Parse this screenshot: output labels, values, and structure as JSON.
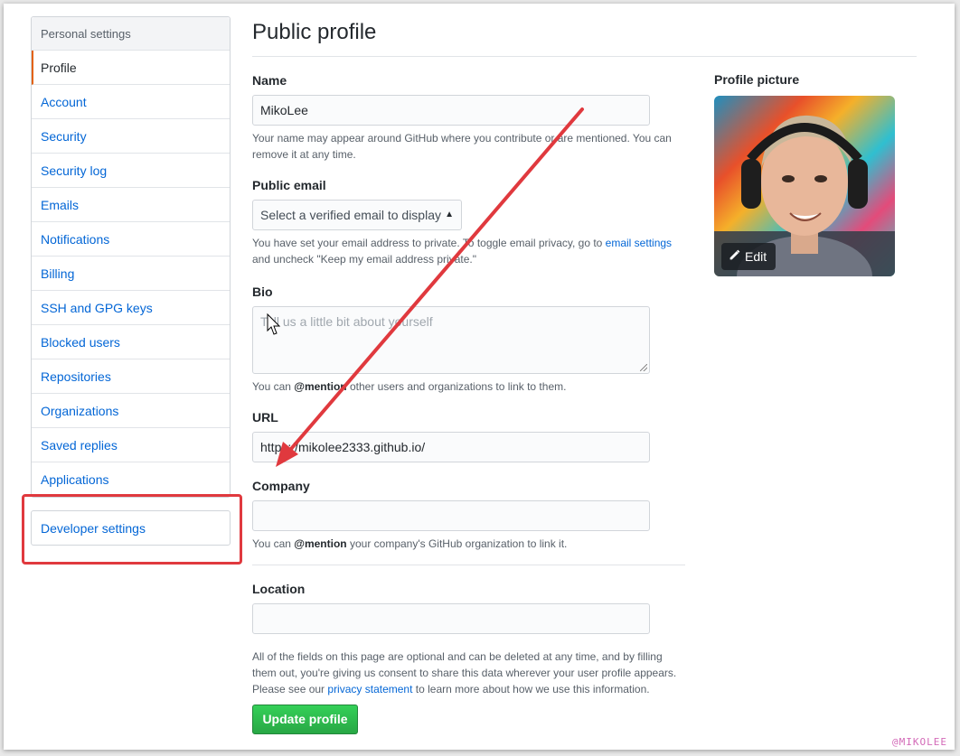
{
  "sidebar": {
    "header": "Personal settings",
    "items": [
      {
        "label": "Profile"
      },
      {
        "label": "Account"
      },
      {
        "label": "Security"
      },
      {
        "label": "Security log"
      },
      {
        "label": "Emails"
      },
      {
        "label": "Notifications"
      },
      {
        "label": "Billing"
      },
      {
        "label": "SSH and GPG keys"
      },
      {
        "label": "Blocked users"
      },
      {
        "label": "Repositories"
      },
      {
        "label": "Organizations"
      },
      {
        "label": "Saved replies"
      },
      {
        "label": "Applications"
      }
    ],
    "developer_settings": "Developer settings"
  },
  "main": {
    "title": "Public profile",
    "name": {
      "label": "Name",
      "value": "MikoLee",
      "note": "Your name may appear around GitHub where you contribute or are mentioned. You can remove it at any time."
    },
    "public_email": {
      "label": "Public email",
      "placeholder": "Select a verified email to display",
      "note_prefix": "You have set your email address to private. To toggle email privacy, go to ",
      "note_link": "email settings",
      "note_suffix": " and uncheck \"Keep my email address private.\""
    },
    "bio": {
      "label": "Bio",
      "placeholder": "Tell us a little bit about yourself",
      "note_prefix": "You can ",
      "note_mention": "@mention",
      "note_suffix": " other users and organizations to link to them."
    },
    "url": {
      "label": "URL",
      "value": "https://mikolee2333.github.io/"
    },
    "company": {
      "label": "Company",
      "value": "",
      "note_prefix": "You can ",
      "note_mention": "@mention",
      "note_suffix": " your company's GitHub organization to link it."
    },
    "location": {
      "label": "Location",
      "value": ""
    },
    "footer_note_prefix": "All of the fields on this page are optional and can be deleted at any time, and by filling them out, you're giving us consent to share this data wherever your user profile appears. Please see our ",
    "footer_note_link": "privacy statement",
    "footer_note_suffix": " to learn more about how we use this information.",
    "update_button": "Update profile"
  },
  "profile_picture": {
    "label": "Profile picture",
    "edit_label": "Edit"
  },
  "watermark": "@MIKOLEE",
  "colors": {
    "link": "#0366d6",
    "annotation_red": "#e0393e",
    "primary_button": "#28a745",
    "active_marker": "#e36209"
  },
  "icons": {
    "edit": "pencil-icon",
    "select": "select-caret-icon",
    "cursor": "mouse-cursor-icon"
  }
}
